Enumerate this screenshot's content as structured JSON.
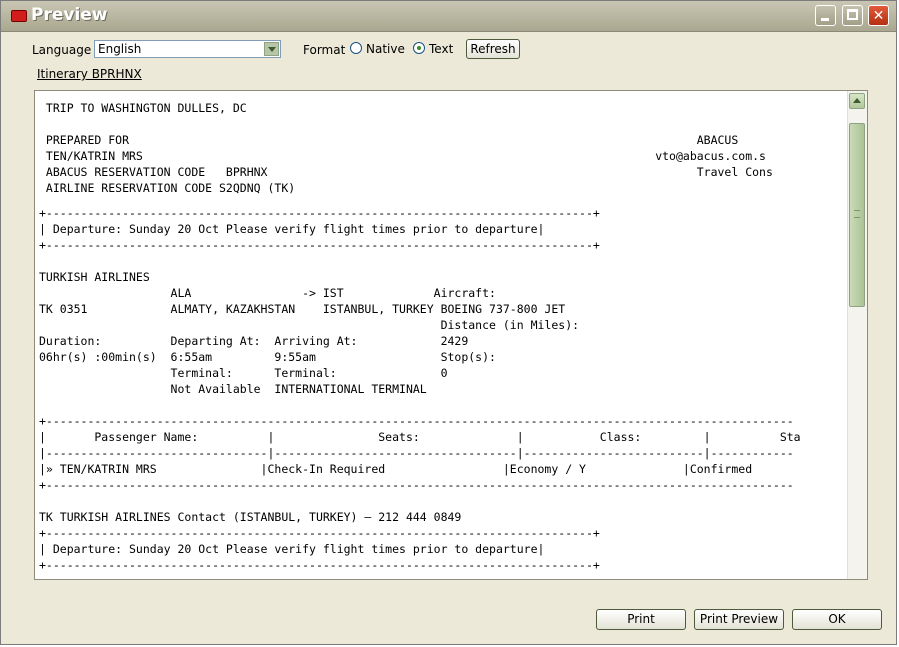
{
  "window": {
    "title": "Preview"
  },
  "toolbar": {
    "language_label": "Language",
    "language_value": "English",
    "format_label": "Format",
    "format_native": "Native",
    "format_text": "Text",
    "format_selected": "Text",
    "refresh_label": "Refresh"
  },
  "itinerary_link": "Itinerary  BPRHNX",
  "report": {
    "lines": [
      " TRIP TO WASHINGTON DULLES, DC",
      "",
      " PREPARED FOR                                                                                  ABACUS",
      " TEN/KATRIN MRS                                                                          vto@abacus.com.s",
      " ABACUS RESERVATION CODE   BPRHNX                                                              Travel Cons",
      " AIRLINE RESERVATION CODE S2QDNQ (TK)",
      "",
      "+-------------------------------------------------------------------------------+",
      "| Departure: Sunday 20 Oct Please verify flight times prior to departure|",
      "+-------------------------------------------------------------------------------+",
      "",
      "TURKISH AIRLINES",
      "                   ALA                -> IST             Aircraft:",
      "TK 0351            ALMATY, KAZAKHSTAN    ISTANBUL, TURKEY BOEING 737-800 JET",
      "                                                          Distance (in Miles):",
      "Duration:          Departing At:  Arriving At:            2429",
      "06hr(s) :00min(s)  6:55am         9:55am                  Stop(s):",
      "                   Terminal:      Terminal:               0",
      "                   Not Available  INTERNATIONAL TERMINAL",
      "",
      "+------------------------------------------------------------------------------------------------------------",
      "|       Passenger Name:          |               Seats:              |           Class:         |          Sta",
      "|--------------------------------|-----------------------------------|--------------------------|------------",
      "|» TEN/KATRIN MRS               |Check-In Required                 |Economy / Y              |Confirmed",
      "+------------------------------------------------------------------------------------------------------------",
      "",
      "TK TURKISH AIRLINES Contact (ISTANBUL, TURKEY) — 212 444 0849",
      "+-------------------------------------------------------------------------------+",
      "| Departure: Sunday 20 Oct Please verify flight times prior to departure|",
      "+-------------------------------------------------------------------------------+"
    ]
  },
  "footer": {
    "print_label": "Print",
    "print_preview_label": "Print Preview",
    "ok_label": "OK"
  },
  "colors": {
    "window_bg": "#ece9d8",
    "title_text": "#ffffff",
    "close_button": "#d4512f"
  }
}
